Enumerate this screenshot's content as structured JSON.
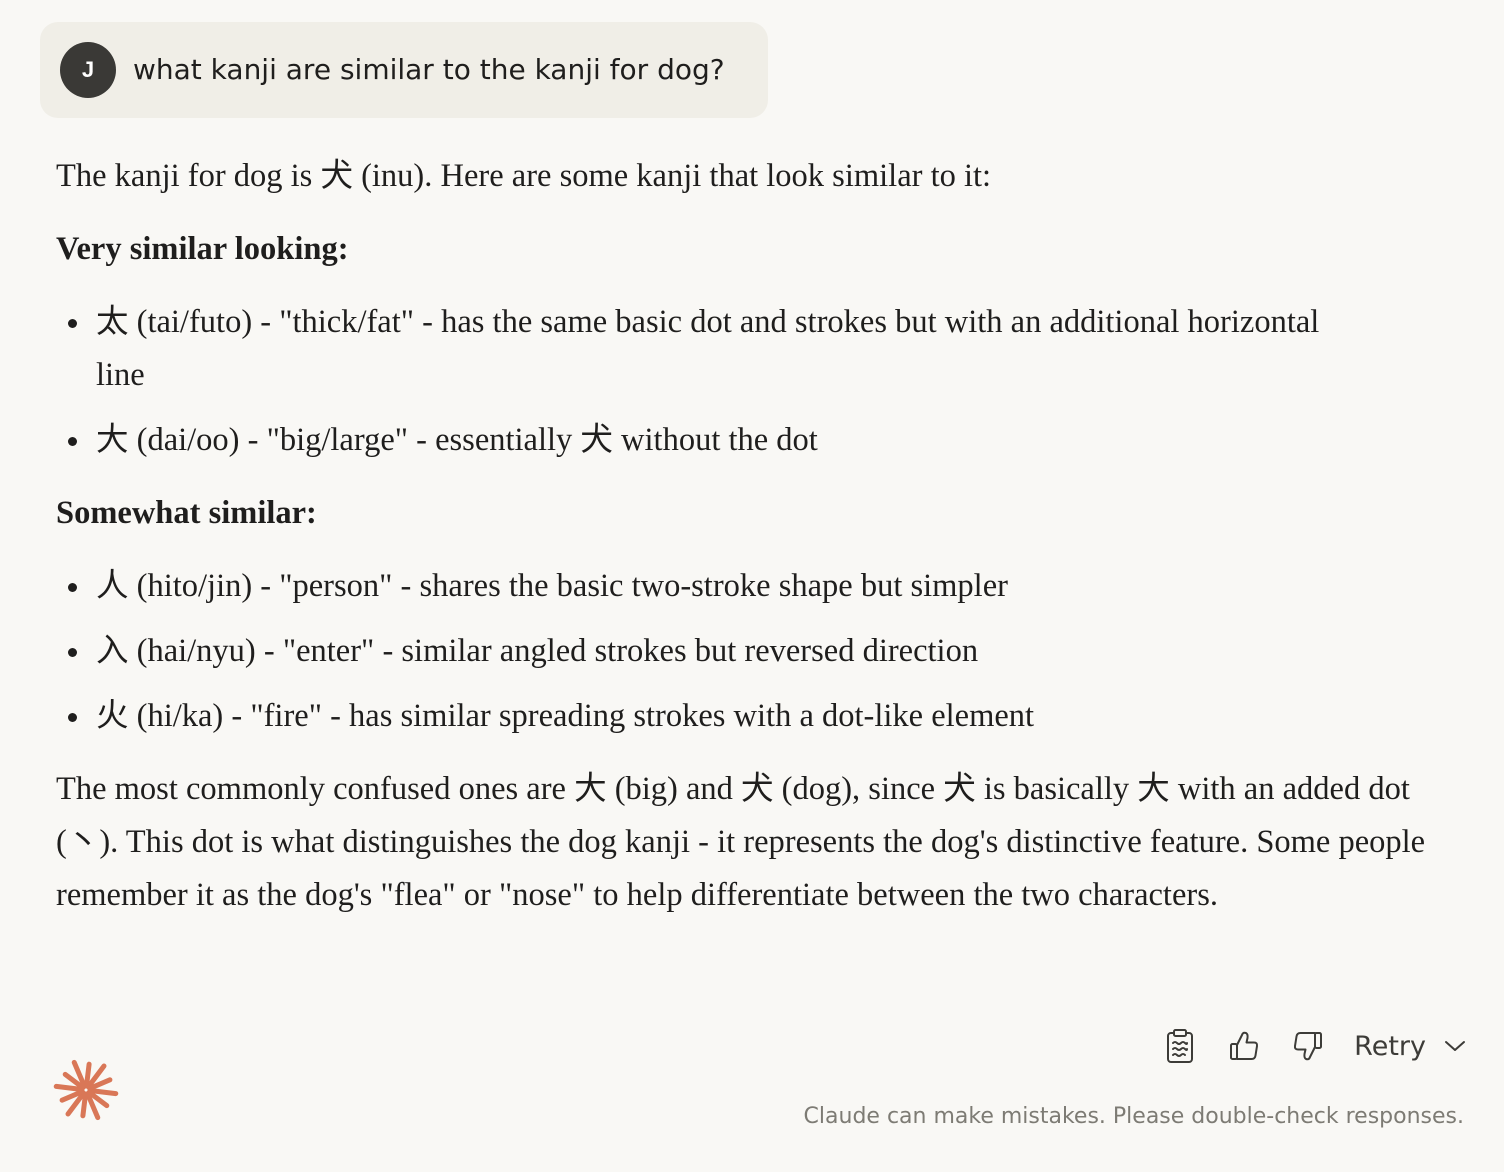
{
  "user_message": {
    "avatar_initial": "J",
    "text": "what kanji are similar to the kanji for dog?"
  },
  "response": {
    "intro": "The kanji for dog is 犬 (inu). Here are some kanji that look similar to it:",
    "sections": [
      {
        "heading": "Very similar looking:",
        "items": [
          "太 (tai/futo) - \"thick/fat\" - has the same basic dot and strokes but with an additional horizontal line",
          "大 (dai/oo) - \"big/large\" - essentially 犬 without the dot"
        ]
      },
      {
        "heading": "Somewhat similar:",
        "items": [
          "人 (hito/jin) - \"person\" - shares the basic two-stroke shape but simpler",
          "入 (hai/nyu) - \"enter\" - similar angled strokes but reversed direction",
          "火 (hi/ka) - \"fire\" - has similar spreading strokes with a dot-like element"
        ]
      }
    ],
    "conclusion": "The most commonly confused ones are 大 (big) and 犬 (dog), since 犬 is basically 大 with an added dot (丶). This dot is what distinguishes the dog kanji - it represents the dog's distinctive feature. Some people remember it as the dog's \"flea\" or \"nose\" to help differentiate between the two characters."
  },
  "actions": {
    "copy_icon": "clipboard-icon",
    "like_icon": "thumbs-up-icon",
    "dislike_icon": "thumbs-down-icon",
    "retry_label": "Retry",
    "retry_icon": "chevron-down-icon"
  },
  "footer": {
    "disclaimer": "Claude can make mistakes. Please double-check responses.",
    "logo_icon": "claude-starburst-icon"
  },
  "colors": {
    "background": "#f9f8f5",
    "user_bubble": "#f0eee7",
    "avatar": "#3a3936",
    "logo": "#d97757",
    "muted_text": "#7d7b74"
  }
}
